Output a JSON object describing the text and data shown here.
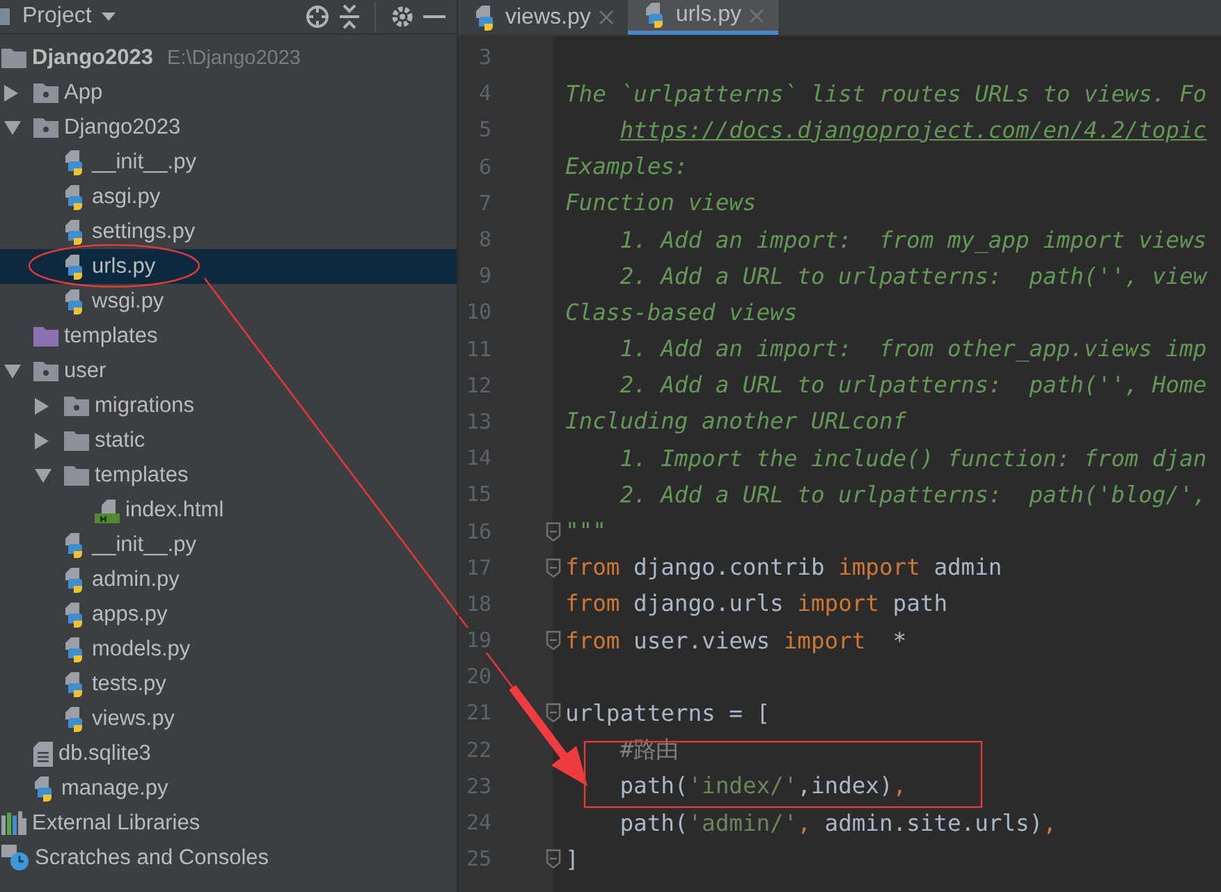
{
  "sidebar": {
    "title": "Project",
    "tree": [
      {
        "name": "Django2023",
        "path": "E:\\Django2023",
        "kind": "project",
        "expanded": true,
        "selected": false,
        "children": [
          {
            "name": "App",
            "kind": "module-folder",
            "expanded": false,
            "selected": false
          },
          {
            "name": "Django2023",
            "kind": "module-folder",
            "expanded": true,
            "selected": false,
            "children": [
              {
                "name": "__init__.py",
                "kind": "python",
                "selected": false
              },
              {
                "name": "asgi.py",
                "kind": "python",
                "selected": false
              },
              {
                "name": "settings.py",
                "kind": "python",
                "selected": false
              },
              {
                "name": "urls.py",
                "kind": "python",
                "selected": true
              },
              {
                "name": "wsgi.py",
                "kind": "python",
                "selected": false
              }
            ]
          },
          {
            "name": "templates",
            "kind": "template-folder",
            "selected": false
          },
          {
            "name": "user",
            "kind": "module-folder",
            "expanded": true,
            "selected": false,
            "children": [
              {
                "name": "migrations",
                "kind": "module-folder",
                "expanded": false,
                "selected": false
              },
              {
                "name": "static",
                "kind": "folder",
                "expanded": false,
                "selected": false
              },
              {
                "name": "templates",
                "kind": "folder",
                "expanded": true,
                "selected": false,
                "children": [
                  {
                    "name": "index.html",
                    "kind": "html",
                    "selected": false
                  }
                ]
              },
              {
                "name": "__init__.py",
                "kind": "python",
                "selected": false
              },
              {
                "name": "admin.py",
                "kind": "python",
                "selected": false
              },
              {
                "name": "apps.py",
                "kind": "python",
                "selected": false
              },
              {
                "name": "models.py",
                "kind": "python",
                "selected": false
              },
              {
                "name": "tests.py",
                "kind": "python",
                "selected": false
              },
              {
                "name": "views.py",
                "kind": "python",
                "selected": false
              }
            ]
          },
          {
            "name": "db.sqlite3",
            "kind": "file",
            "selected": false
          },
          {
            "name": "manage.py",
            "kind": "python",
            "selected": false
          }
        ]
      },
      {
        "name": "External Libraries",
        "kind": "libraries",
        "selected": false
      },
      {
        "name": "Scratches and Consoles",
        "kind": "scratches",
        "selected": false
      }
    ]
  },
  "editor_tabs": [
    {
      "label": "views.py",
      "selected": false
    },
    {
      "label": "urls.py",
      "selected": true
    }
  ],
  "code_lines": [
    {
      "number": "3"
    },
    {
      "number": "4",
      "tokens": [
        {
          "kind": "doc",
          "text": "The `urlpatterns` list routes URLs to views. Fo"
        }
      ]
    },
    {
      "number": "5",
      "indent": true,
      "tokens": [
        {
          "kind": "link",
          "text": "https://docs.djangoproject.com/en/4.2/topic"
        }
      ]
    },
    {
      "number": "6",
      "tokens": [
        {
          "kind": "doc",
          "text": "Examples:"
        }
      ]
    },
    {
      "number": "7",
      "tokens": [
        {
          "kind": "doc",
          "text": "Function views"
        }
      ]
    },
    {
      "number": "8",
      "tokens": [
        {
          "kind": "doc",
          "text": "    1. Add an import:  from my_app import views"
        }
      ]
    },
    {
      "number": "9",
      "tokens": [
        {
          "kind": "doc",
          "text": "    2. Add a URL to urlpatterns:  path('', view"
        }
      ]
    },
    {
      "number": "10",
      "tokens": [
        {
          "kind": "doc",
          "text": "Class-based views"
        }
      ]
    },
    {
      "number": "11",
      "tokens": [
        {
          "kind": "doc",
          "text": "    1. Add an import:  from other_app.views imp"
        }
      ]
    },
    {
      "number": "12",
      "tokens": [
        {
          "kind": "doc",
          "text": "    2. Add a URL to urlpatterns:  path('', Home"
        }
      ]
    },
    {
      "number": "13",
      "tokens": [
        {
          "kind": "doc",
          "text": "Including another URLconf"
        }
      ]
    },
    {
      "number": "14",
      "tokens": [
        {
          "kind": "doc",
          "text": "    1. Import the include() function: from djan"
        }
      ]
    },
    {
      "number": "15",
      "tokens": [
        {
          "kind": "doc",
          "text": "    2. Add a URL to urlpatterns:  path('blog/',"
        }
      ]
    },
    {
      "number": "16",
      "fold": true,
      "tokens": [
        {
          "kind": "doc",
          "text": "\"\"\""
        }
      ]
    },
    {
      "number": "17",
      "fold": true,
      "tokens": [
        {
          "kind": "kw",
          "text": "from "
        },
        {
          "kind": "plain",
          "text": "django.contrib "
        },
        {
          "kind": "kw",
          "text": "import "
        },
        {
          "kind": "plain",
          "text": "admin"
        }
      ]
    },
    {
      "number": "18",
      "tokens": [
        {
          "kind": "kw",
          "text": "from "
        },
        {
          "kind": "plain",
          "text": "django.urls "
        },
        {
          "kind": "kw",
          "text": "import "
        },
        {
          "kind": "plain",
          "text": "path"
        }
      ]
    },
    {
      "number": "19",
      "fold": true,
      "tokens": [
        {
          "kind": "kw",
          "text": "from "
        },
        {
          "kind": "plain",
          "text": "user.views "
        },
        {
          "kind": "kw",
          "text": "import  "
        },
        {
          "kind": "plain",
          "text": "*"
        }
      ]
    },
    {
      "number": "20"
    },
    {
      "number": "21",
      "fold": true,
      "tokens": [
        {
          "kind": "plain",
          "text": "urlpatterns = ["
        }
      ]
    },
    {
      "number": "22",
      "indent": true,
      "tokens": [
        {
          "kind": "comment",
          "text": "#路由"
        }
      ]
    },
    {
      "number": "23",
      "tokens": [
        {
          "kind": "plain",
          "text": "    path("
        },
        {
          "kind": "str",
          "text": "'index/'"
        },
        {
          "kind": "plain",
          "text": ",index)"
        },
        {
          "kind": "kw",
          "text": ","
        }
      ]
    },
    {
      "number": "24",
      "tokens": [
        {
          "kind": "plain",
          "text": "    path("
        },
        {
          "kind": "str",
          "text": "'admin/'"
        },
        {
          "kind": "kw",
          "text": ", "
        },
        {
          "kind": "plain",
          "text": "admin.site.urls)"
        },
        {
          "kind": "kw",
          "text": ","
        }
      ]
    },
    {
      "number": "25",
      "fold": true,
      "tokens": [
        {
          "kind": "plain",
          "text": "]"
        }
      ]
    }
  ]
}
